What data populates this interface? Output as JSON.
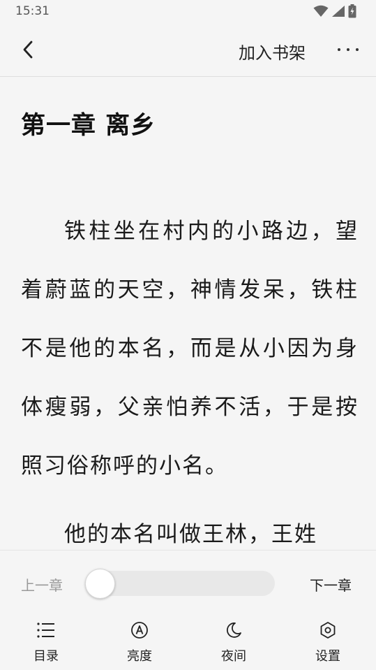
{
  "status_bar": {
    "time": "15:31"
  },
  "header": {
    "add_to_shelf": "加入书架"
  },
  "chapter": {
    "title": "第一章 离乡",
    "paragraphs": [
      "铁柱坐在村内的小路边，望着蔚蓝的天空，神情发呆，铁柱不是他的本名，而是从小因为身体瘦弱，父亲怕养不活，于是按照习俗称呼的小名。",
      "他的本名叫做王林，王姓"
    ]
  },
  "controls": {
    "prev_chapter": "上一章",
    "next_chapter": "下一章",
    "progress": 0
  },
  "nav": {
    "catalog": "目录",
    "brightness": "亮度",
    "night": "夜间",
    "settings": "设置"
  },
  "colors": {
    "background": "#f5f5f5",
    "text": "#111111",
    "muted": "#999999",
    "track": "#e8e8e8"
  }
}
